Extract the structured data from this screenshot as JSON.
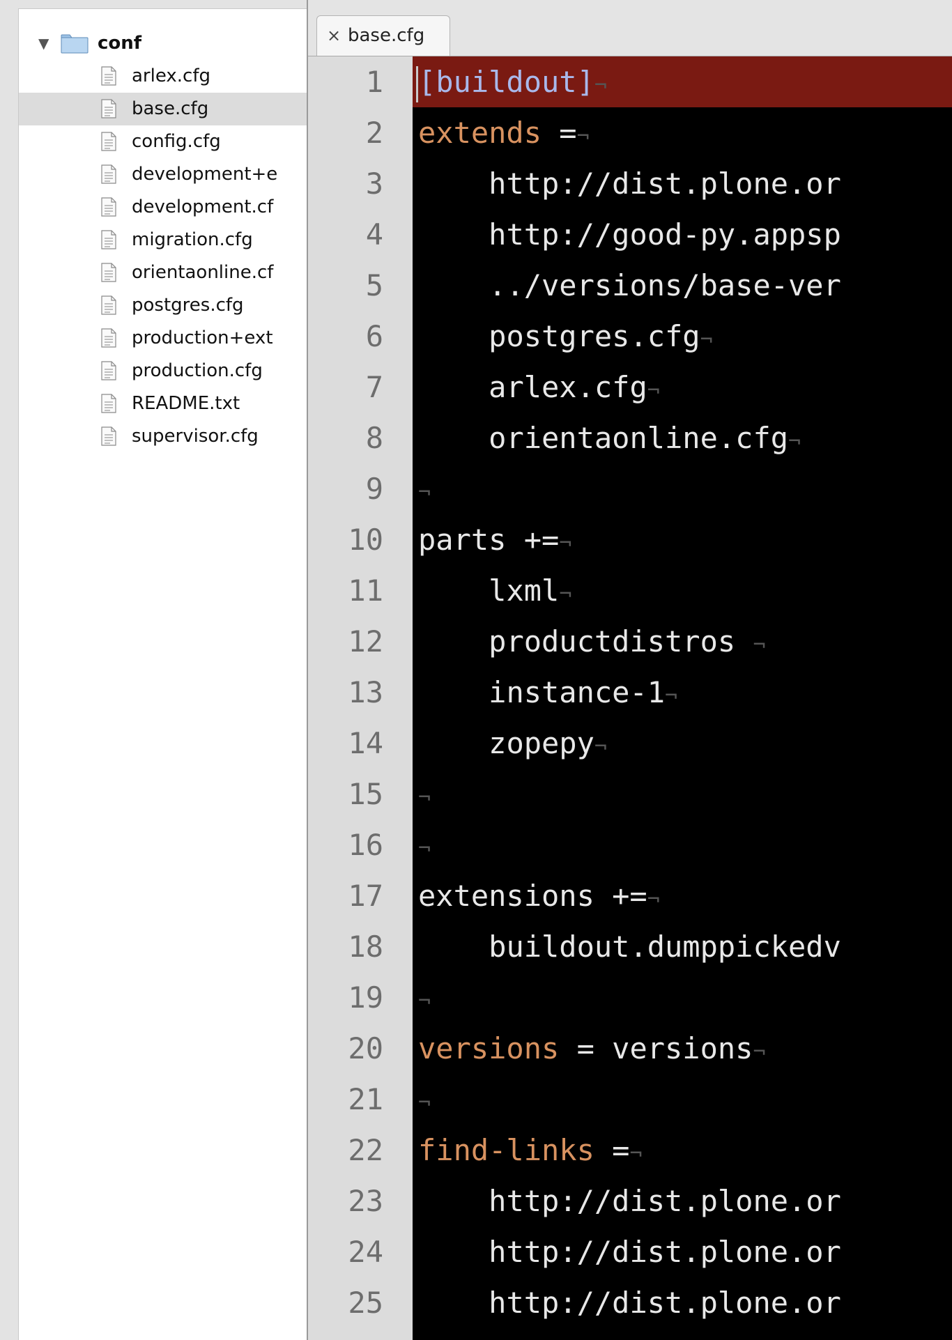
{
  "sidebar": {
    "folder": {
      "name": "conf",
      "expanded": true
    },
    "files": [
      {
        "name": "arlex.cfg",
        "selected": false
      },
      {
        "name": "base.cfg",
        "selected": true
      },
      {
        "name": "config.cfg",
        "selected": false
      },
      {
        "name": "development+e",
        "selected": false
      },
      {
        "name": "development.cf",
        "selected": false
      },
      {
        "name": "migration.cfg",
        "selected": false
      },
      {
        "name": "orientaonline.cf",
        "selected": false
      },
      {
        "name": "postgres.cfg",
        "selected": false
      },
      {
        "name": "production+ext",
        "selected": false
      },
      {
        "name": "production.cfg",
        "selected": false
      },
      {
        "name": "README.txt",
        "selected": false
      },
      {
        "name": "supervisor.cfg",
        "selected": false
      }
    ]
  },
  "tab": {
    "close": "×",
    "label": "base.cfg"
  },
  "editor": {
    "eol_marker": "¬",
    "lines": [
      {
        "no": "1",
        "indent": "",
        "section": "[buildout]",
        "highlight": true,
        "eol": true
      },
      {
        "no": "2",
        "indent": "",
        "key": "extends",
        "text": " =",
        "eol": true
      },
      {
        "no": "3",
        "indent": "    ",
        "text": "http://dist.plone.or",
        "eol": false
      },
      {
        "no": "4",
        "indent": "    ",
        "text": "http://good-py.appsp",
        "eol": false
      },
      {
        "no": "5",
        "indent": "    ",
        "text": "../versions/base-ver",
        "eol": false
      },
      {
        "no": "6",
        "indent": "    ",
        "text": "postgres.cfg",
        "eol": true
      },
      {
        "no": "7",
        "indent": "    ",
        "text": "arlex.cfg",
        "eol": true
      },
      {
        "no": "8",
        "indent": "    ",
        "text": "orientaonline.cfg",
        "eol": true
      },
      {
        "no": "9",
        "indent": "",
        "text": "",
        "eol": true
      },
      {
        "no": "10",
        "indent": "",
        "text": "parts +=",
        "eol": true
      },
      {
        "no": "11",
        "indent": "    ",
        "text": "lxml",
        "eol": true
      },
      {
        "no": "12",
        "indent": "    ",
        "text": "productdistros ",
        "eol": true
      },
      {
        "no": "13",
        "indent": "    ",
        "text": "instance-1",
        "eol": true
      },
      {
        "no": "14",
        "indent": "    ",
        "text": "zopepy",
        "eol": true
      },
      {
        "no": "15",
        "indent": "",
        "text": "",
        "eol": true
      },
      {
        "no": "16",
        "indent": "",
        "text": "",
        "eol": true
      },
      {
        "no": "17",
        "indent": "",
        "text": "extensions +=",
        "eol": true
      },
      {
        "no": "18",
        "indent": "    ",
        "text": "buildout.dumppickedv",
        "eol": false
      },
      {
        "no": "19",
        "indent": "",
        "text": "",
        "eol": true
      },
      {
        "no": "20",
        "indent": "",
        "key": "versions",
        "text": " = versions",
        "eol": true
      },
      {
        "no": "21",
        "indent": "",
        "text": "",
        "eol": true
      },
      {
        "no": "22",
        "indent": "",
        "key": "find-links",
        "text": " =",
        "eol": true
      },
      {
        "no": "23",
        "indent": "    ",
        "text": "http://dist.plone.or",
        "eol": false
      },
      {
        "no": "24",
        "indent": "    ",
        "text": "http://dist.plone.or",
        "eol": false
      },
      {
        "no": "25",
        "indent": "    ",
        "text": "http://dist.plone.or",
        "eol": false
      }
    ]
  },
  "colors": {
    "editor_background": "#000000",
    "current_line_highlight": "#7a1a12",
    "keyword": "#d89260",
    "section_header": "#a9b8ea",
    "plain_text": "#e8e8e8",
    "gutter_background": "#dcdcdc",
    "line_number": "#6d6d6d"
  }
}
